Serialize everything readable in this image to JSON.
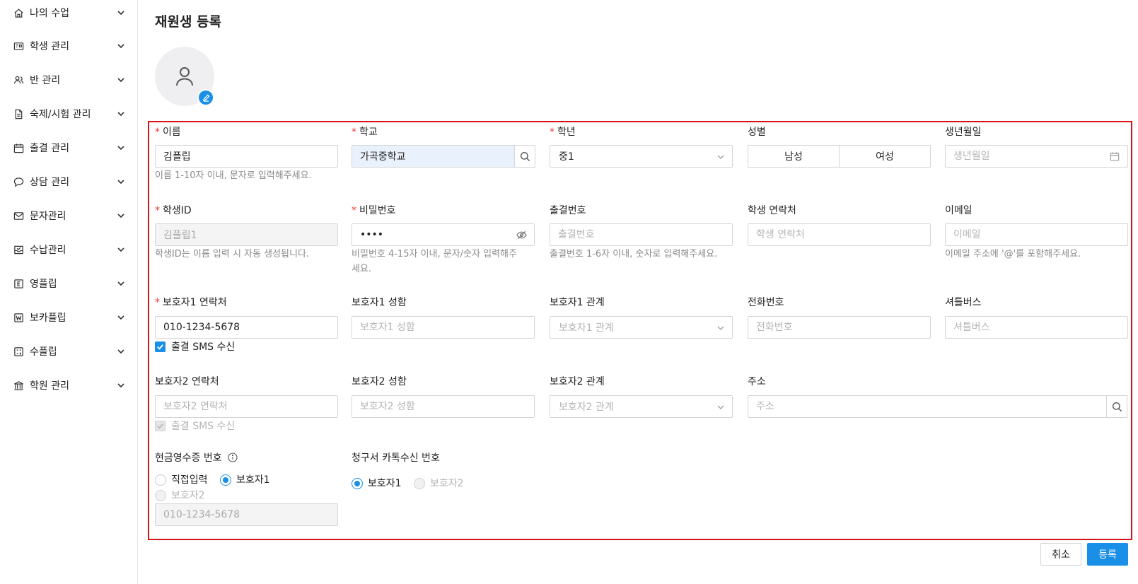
{
  "sidebar": {
    "items": [
      {
        "label": "나의 수업",
        "icon": "home-icon"
      },
      {
        "label": "학생 관리",
        "icon": "id-card-icon"
      },
      {
        "label": "반 관리",
        "icon": "users-icon"
      },
      {
        "label": "숙제/시험 관리",
        "icon": "document-icon"
      },
      {
        "label": "출결 관리",
        "icon": "calendar-icon"
      },
      {
        "label": "상담 관리",
        "icon": "chat-icon"
      },
      {
        "label": "문자관리",
        "icon": "mail-icon"
      },
      {
        "label": "수납관리",
        "icon": "inbox-check-icon"
      },
      {
        "label": "영플립",
        "icon": "e-badge-icon"
      },
      {
        "label": "보카플립",
        "icon": "w-badge-icon"
      },
      {
        "label": "수플립",
        "icon": "grid-icon"
      },
      {
        "label": "학원 관리",
        "icon": "building-icon"
      }
    ]
  },
  "page": {
    "title": "재원생 등록"
  },
  "colors": {
    "accent": "#1a8fe8",
    "required": "#e53935",
    "highlight": "#d9121a"
  },
  "form": {
    "name": {
      "label": "이름",
      "value": "김플립",
      "help": "이름 1-10자 이내, 문자로 입력해주세요."
    },
    "school": {
      "label": "학교",
      "value": "가곡중학교"
    },
    "grade": {
      "label": "학년",
      "value": "중1"
    },
    "gender": {
      "label": "성별",
      "options": [
        "남성",
        "여성"
      ]
    },
    "birth": {
      "label": "생년월일",
      "placeholder": "생년월일"
    },
    "student_id": {
      "label": "학생ID",
      "value": "김플립1",
      "help": "학생ID는 이름 입력 시 자동 생성됩니다."
    },
    "password": {
      "label": "비밀번호",
      "value": "••••",
      "help1": "비밀번호 4-15자 이내, 문자/숫자 입력해주",
      "help2": "세요."
    },
    "attendance_no": {
      "label": "출결번호",
      "placeholder": "출결번호",
      "help": "출결번호 1-6자 이내, 숫자로 입력해주세요."
    },
    "student_phone": {
      "label": "학생 연락처",
      "placeholder": "학생 연락처"
    },
    "email": {
      "label": "이메일",
      "placeholder": "이메일",
      "help": "이메일 주소에 '@'를 포함해주세요."
    },
    "guardian1_phone": {
      "label": "보호자1 연락처",
      "value": "010-1234-5678",
      "sms_label": "출결 SMS 수신"
    },
    "guardian1_name": {
      "label": "보호자1 성함",
      "placeholder": "보호자1 성함"
    },
    "guardian1_relation": {
      "label": "보호자1 관계",
      "placeholder": "보호자1 관계"
    },
    "phone": {
      "label": "전화번호",
      "placeholder": "전화번호"
    },
    "shuttle": {
      "label": "셔틀버스",
      "placeholder": "셔틀버스"
    },
    "guardian2_phone": {
      "label": "보호자2 연락처",
      "placeholder": "보호자2 연락처",
      "sms_label": "출결 SMS 수신"
    },
    "guardian2_name": {
      "label": "보호자2 성함",
      "placeholder": "보호자2 성함"
    },
    "guardian2_relation": {
      "label": "보호자2 관계",
      "placeholder": "보호자2 관계"
    },
    "address": {
      "label": "주소",
      "placeholder": "주소"
    },
    "cash_receipt": {
      "label": "현금영수증 번호",
      "options": [
        "직접입력",
        "보호자1",
        "보호자2"
      ],
      "selected": "보호자1",
      "value": "010-1234-5678"
    },
    "invoice_kakao": {
      "label": "청구서 카톡수신 번호",
      "options": [
        "보호자1",
        "보호자2"
      ],
      "selected": "보호자1"
    }
  },
  "actions": {
    "cancel": "취소",
    "submit": "등록"
  }
}
